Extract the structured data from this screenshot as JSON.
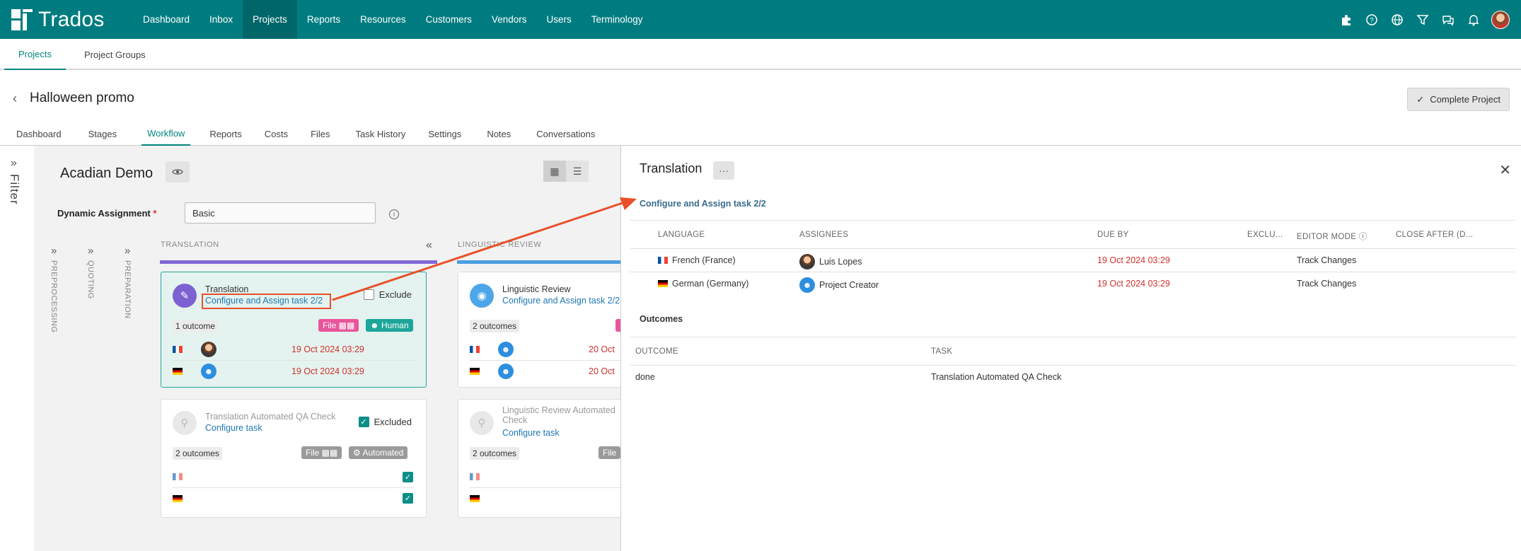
{
  "app": {
    "name": "Trados"
  },
  "nav": [
    "Dashboard",
    "Inbox",
    "Projects",
    "Reports",
    "Resources",
    "Customers",
    "Vendors",
    "Users",
    "Terminology"
  ],
  "top_icons": [
    "puzzle-icon",
    "help-icon",
    "globe-icon",
    "filter-icon",
    "chat-icon",
    "bell-icon"
  ],
  "subnav": [
    "Projects",
    "Project Groups"
  ],
  "project": {
    "title": "Halloween promo",
    "complete_label": "Complete Project"
  },
  "tabs": [
    "Dashboard",
    "Stages",
    "Workflow",
    "Reports",
    "Costs",
    "Files",
    "Task History",
    "Settings",
    "Notes",
    "Conversations"
  ],
  "filter": {
    "label": "Filter"
  },
  "board": {
    "title": "Acadian Demo",
    "dynamic_assignment_label": "Dynamic Assignment",
    "required_mark": "*",
    "dynamic_assignment_value": "Basic",
    "collapsed_stages": [
      "PREPROCESSING",
      "QUOTING",
      "PREPARATION"
    ],
    "stages": [
      "TRANSLATION",
      "LINGUISTIC REVIEW"
    ],
    "cards": {
      "translation": {
        "title": "Translation",
        "link": "Configure and Assign task 2/2",
        "check_label": "Exclude",
        "outcomes": "1 outcome",
        "file_pill": "File",
        "human_pill": "Human",
        "rows": [
          {
            "lang": "fr",
            "due": "19 Oct 2024 03:29"
          },
          {
            "lang": "de",
            "due": "19 Oct 2024 03:29"
          }
        ]
      },
      "linguistic_review": {
        "title": "Linguistic Review",
        "link": "Configure and Assign task 2/2",
        "outcomes": "2 outcomes",
        "rows": [
          {
            "lang": "fr",
            "due": "20 Oct"
          },
          {
            "lang": "de",
            "due": "20 Oct"
          }
        ]
      },
      "translation_qa": {
        "title": "Translation Automated QA Check",
        "link": "Configure task",
        "check_label": "Excluded",
        "outcomes": "2 outcomes",
        "file_pill": "File",
        "automated_pill": "Automated"
      },
      "review_qa": {
        "title_line1": "Linguistic Review Automated",
        "title_line2": "Check",
        "link": "Configure task",
        "outcomes": "2 outcomes",
        "file_pill": "File"
      }
    }
  },
  "panel": {
    "title": "Translation",
    "more": "···",
    "assign_section": "Configure and Assign task 2/2",
    "columns": [
      "LANGUAGE",
      "ASSIGNEES",
      "DUE BY",
      "EXCLU...",
      "EDITOR MODE",
      "CLOSE AFTER (D..."
    ],
    "rows": [
      {
        "language": "French (France)",
        "assignee": "Luis Lopes",
        "due": "19 Oct 2024 03:29",
        "editor_mode": "Track Changes"
      },
      {
        "language": "German (Germany)",
        "assignee": "Project Creator",
        "due": "19 Oct 2024 03:29",
        "editor_mode": "Track Changes"
      }
    ],
    "outcomes_section": "Outcomes",
    "outcome_columns": [
      "OUTCOME",
      "TASK"
    ],
    "outcome_rows": [
      {
        "outcome": "done",
        "task": "Translation Automated QA Check"
      }
    ]
  },
  "colors": {
    "brand": "#007c80",
    "accent": "#00867f",
    "link": "#1f78b4",
    "due": "#d0312d",
    "pink": "#e8559a",
    "annotation": "#e8502a"
  }
}
